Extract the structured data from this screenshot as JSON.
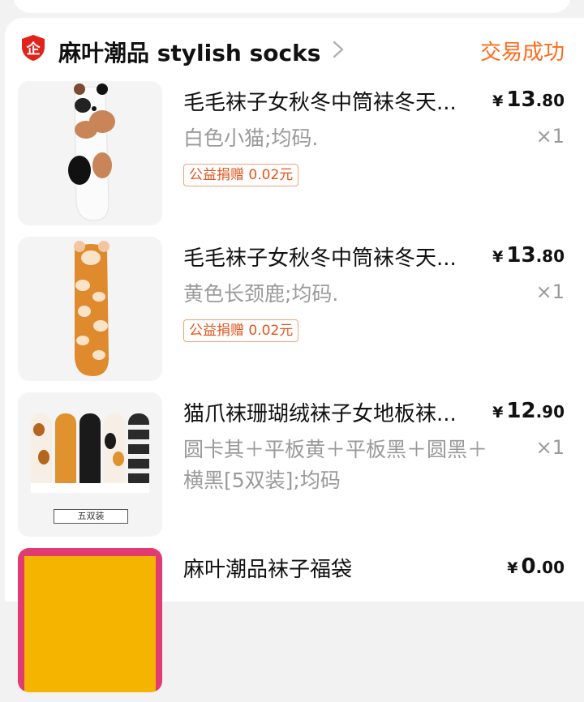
{
  "shop": {
    "name": "麻叶潮品 stylish socks",
    "badge_icon": "enterprise-shield-icon",
    "badge_text": "企",
    "badge_color": "#e2231a",
    "status": "交易成功",
    "status_color": "#ff6a1a"
  },
  "items": [
    {
      "title": "毛毛袜子女秋冬中筒袜冬天...",
      "spec": "白色小猫;均码.",
      "currency": "¥",
      "price_int": "13",
      "price_dec": ".80",
      "qty": "×1",
      "tag": "公益捐赠 0.02元",
      "image": "white-cat-sock-image"
    },
    {
      "title": "毛毛袜子女秋冬中筒袜冬天...",
      "spec": "黄色长颈鹿;均码.",
      "currency": "¥",
      "price_int": "13",
      "price_dec": ".80",
      "qty": "×1",
      "tag": "公益捐赠 0.02元",
      "image": "giraffe-sock-image"
    },
    {
      "title": "猫爪袜珊瑚绒袜子女地板袜...",
      "spec": "圆卡其＋平板黄＋平板黑＋圆黑＋横黑[5双装];均码",
      "currency": "¥",
      "price_int": "12",
      "price_dec": ".90",
      "qty": "×1",
      "image": "cat-paw-socks-five-pack-image",
      "image_label": "五双装"
    },
    {
      "title": "麻叶潮品袜子福袋",
      "currency": "¥",
      "price_int": "0",
      "price_dec": ".00",
      "image": "lucky-bag-image"
    }
  ]
}
